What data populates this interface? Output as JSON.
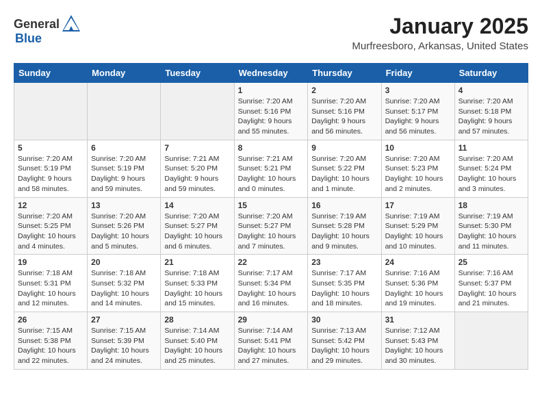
{
  "header": {
    "logo_general": "General",
    "logo_blue": "Blue",
    "month": "January 2025",
    "location": "Murfreesboro, Arkansas, United States"
  },
  "days_of_week": [
    "Sunday",
    "Monday",
    "Tuesday",
    "Wednesday",
    "Thursday",
    "Friday",
    "Saturday"
  ],
  "weeks": [
    [
      {
        "day": "",
        "info": ""
      },
      {
        "day": "",
        "info": ""
      },
      {
        "day": "",
        "info": ""
      },
      {
        "day": "1",
        "info": "Sunrise: 7:20 AM\nSunset: 5:16 PM\nDaylight: 9 hours and 55 minutes."
      },
      {
        "day": "2",
        "info": "Sunrise: 7:20 AM\nSunset: 5:16 PM\nDaylight: 9 hours and 56 minutes."
      },
      {
        "day": "3",
        "info": "Sunrise: 7:20 AM\nSunset: 5:17 PM\nDaylight: 9 hours and 56 minutes."
      },
      {
        "day": "4",
        "info": "Sunrise: 7:20 AM\nSunset: 5:18 PM\nDaylight: 9 hours and 57 minutes."
      }
    ],
    [
      {
        "day": "5",
        "info": "Sunrise: 7:20 AM\nSunset: 5:19 PM\nDaylight: 9 hours and 58 minutes."
      },
      {
        "day": "6",
        "info": "Sunrise: 7:20 AM\nSunset: 5:19 PM\nDaylight: 9 hours and 59 minutes."
      },
      {
        "day": "7",
        "info": "Sunrise: 7:21 AM\nSunset: 5:20 PM\nDaylight: 9 hours and 59 minutes."
      },
      {
        "day": "8",
        "info": "Sunrise: 7:21 AM\nSunset: 5:21 PM\nDaylight: 10 hours and 0 minutes."
      },
      {
        "day": "9",
        "info": "Sunrise: 7:20 AM\nSunset: 5:22 PM\nDaylight: 10 hours and 1 minute."
      },
      {
        "day": "10",
        "info": "Sunrise: 7:20 AM\nSunset: 5:23 PM\nDaylight: 10 hours and 2 minutes."
      },
      {
        "day": "11",
        "info": "Sunrise: 7:20 AM\nSunset: 5:24 PM\nDaylight: 10 hours and 3 minutes."
      }
    ],
    [
      {
        "day": "12",
        "info": "Sunrise: 7:20 AM\nSunset: 5:25 PM\nDaylight: 10 hours and 4 minutes."
      },
      {
        "day": "13",
        "info": "Sunrise: 7:20 AM\nSunset: 5:26 PM\nDaylight: 10 hours and 5 minutes."
      },
      {
        "day": "14",
        "info": "Sunrise: 7:20 AM\nSunset: 5:27 PM\nDaylight: 10 hours and 6 minutes."
      },
      {
        "day": "15",
        "info": "Sunrise: 7:20 AM\nSunset: 5:27 PM\nDaylight: 10 hours and 7 minutes."
      },
      {
        "day": "16",
        "info": "Sunrise: 7:19 AM\nSunset: 5:28 PM\nDaylight: 10 hours and 9 minutes."
      },
      {
        "day": "17",
        "info": "Sunrise: 7:19 AM\nSunset: 5:29 PM\nDaylight: 10 hours and 10 minutes."
      },
      {
        "day": "18",
        "info": "Sunrise: 7:19 AM\nSunset: 5:30 PM\nDaylight: 10 hours and 11 minutes."
      }
    ],
    [
      {
        "day": "19",
        "info": "Sunrise: 7:18 AM\nSunset: 5:31 PM\nDaylight: 10 hours and 12 minutes."
      },
      {
        "day": "20",
        "info": "Sunrise: 7:18 AM\nSunset: 5:32 PM\nDaylight: 10 hours and 14 minutes."
      },
      {
        "day": "21",
        "info": "Sunrise: 7:18 AM\nSunset: 5:33 PM\nDaylight: 10 hours and 15 minutes."
      },
      {
        "day": "22",
        "info": "Sunrise: 7:17 AM\nSunset: 5:34 PM\nDaylight: 10 hours and 16 minutes."
      },
      {
        "day": "23",
        "info": "Sunrise: 7:17 AM\nSunset: 5:35 PM\nDaylight: 10 hours and 18 minutes."
      },
      {
        "day": "24",
        "info": "Sunrise: 7:16 AM\nSunset: 5:36 PM\nDaylight: 10 hours and 19 minutes."
      },
      {
        "day": "25",
        "info": "Sunrise: 7:16 AM\nSunset: 5:37 PM\nDaylight: 10 hours and 21 minutes."
      }
    ],
    [
      {
        "day": "26",
        "info": "Sunrise: 7:15 AM\nSunset: 5:38 PM\nDaylight: 10 hours and 22 minutes."
      },
      {
        "day": "27",
        "info": "Sunrise: 7:15 AM\nSunset: 5:39 PM\nDaylight: 10 hours and 24 minutes."
      },
      {
        "day": "28",
        "info": "Sunrise: 7:14 AM\nSunset: 5:40 PM\nDaylight: 10 hours and 25 minutes."
      },
      {
        "day": "29",
        "info": "Sunrise: 7:14 AM\nSunset: 5:41 PM\nDaylight: 10 hours and 27 minutes."
      },
      {
        "day": "30",
        "info": "Sunrise: 7:13 AM\nSunset: 5:42 PM\nDaylight: 10 hours and 29 minutes."
      },
      {
        "day": "31",
        "info": "Sunrise: 7:12 AM\nSunset: 5:43 PM\nDaylight: 10 hours and 30 minutes."
      },
      {
        "day": "",
        "info": ""
      }
    ]
  ]
}
